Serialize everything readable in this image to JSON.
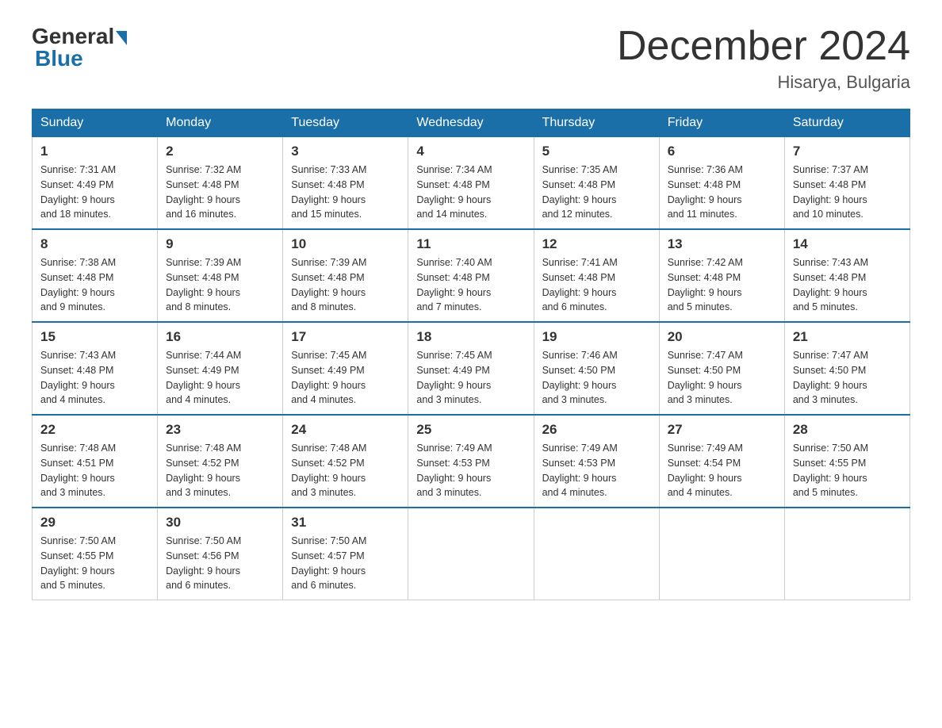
{
  "header": {
    "logo_general": "General",
    "logo_blue": "Blue",
    "month_title": "December 2024",
    "location": "Hisarya, Bulgaria"
  },
  "weekdays": [
    "Sunday",
    "Monday",
    "Tuesday",
    "Wednesday",
    "Thursday",
    "Friday",
    "Saturday"
  ],
  "weeks": [
    [
      {
        "day": "1",
        "sunrise": "7:31 AM",
        "sunset": "4:49 PM",
        "daylight": "9 hours and 18 minutes."
      },
      {
        "day": "2",
        "sunrise": "7:32 AM",
        "sunset": "4:48 PM",
        "daylight": "9 hours and 16 minutes."
      },
      {
        "day": "3",
        "sunrise": "7:33 AM",
        "sunset": "4:48 PM",
        "daylight": "9 hours and 15 minutes."
      },
      {
        "day": "4",
        "sunrise": "7:34 AM",
        "sunset": "4:48 PM",
        "daylight": "9 hours and 14 minutes."
      },
      {
        "day": "5",
        "sunrise": "7:35 AM",
        "sunset": "4:48 PM",
        "daylight": "9 hours and 12 minutes."
      },
      {
        "day": "6",
        "sunrise": "7:36 AM",
        "sunset": "4:48 PM",
        "daylight": "9 hours and 11 minutes."
      },
      {
        "day": "7",
        "sunrise": "7:37 AM",
        "sunset": "4:48 PM",
        "daylight": "9 hours and 10 minutes."
      }
    ],
    [
      {
        "day": "8",
        "sunrise": "7:38 AM",
        "sunset": "4:48 PM",
        "daylight": "9 hours and 9 minutes."
      },
      {
        "day": "9",
        "sunrise": "7:39 AM",
        "sunset": "4:48 PM",
        "daylight": "9 hours and 8 minutes."
      },
      {
        "day": "10",
        "sunrise": "7:39 AM",
        "sunset": "4:48 PM",
        "daylight": "9 hours and 8 minutes."
      },
      {
        "day": "11",
        "sunrise": "7:40 AM",
        "sunset": "4:48 PM",
        "daylight": "9 hours and 7 minutes."
      },
      {
        "day": "12",
        "sunrise": "7:41 AM",
        "sunset": "4:48 PM",
        "daylight": "9 hours and 6 minutes."
      },
      {
        "day": "13",
        "sunrise": "7:42 AM",
        "sunset": "4:48 PM",
        "daylight": "9 hours and 5 minutes."
      },
      {
        "day": "14",
        "sunrise": "7:43 AM",
        "sunset": "4:48 PM",
        "daylight": "9 hours and 5 minutes."
      }
    ],
    [
      {
        "day": "15",
        "sunrise": "7:43 AM",
        "sunset": "4:48 PM",
        "daylight": "9 hours and 4 minutes."
      },
      {
        "day": "16",
        "sunrise": "7:44 AM",
        "sunset": "4:49 PM",
        "daylight": "9 hours and 4 minutes."
      },
      {
        "day": "17",
        "sunrise": "7:45 AM",
        "sunset": "4:49 PM",
        "daylight": "9 hours and 4 minutes."
      },
      {
        "day": "18",
        "sunrise": "7:45 AM",
        "sunset": "4:49 PM",
        "daylight": "9 hours and 3 minutes."
      },
      {
        "day": "19",
        "sunrise": "7:46 AM",
        "sunset": "4:50 PM",
        "daylight": "9 hours and 3 minutes."
      },
      {
        "day": "20",
        "sunrise": "7:47 AM",
        "sunset": "4:50 PM",
        "daylight": "9 hours and 3 minutes."
      },
      {
        "day": "21",
        "sunrise": "7:47 AM",
        "sunset": "4:50 PM",
        "daylight": "9 hours and 3 minutes."
      }
    ],
    [
      {
        "day": "22",
        "sunrise": "7:48 AM",
        "sunset": "4:51 PM",
        "daylight": "9 hours and 3 minutes."
      },
      {
        "day": "23",
        "sunrise": "7:48 AM",
        "sunset": "4:52 PM",
        "daylight": "9 hours and 3 minutes."
      },
      {
        "day": "24",
        "sunrise": "7:48 AM",
        "sunset": "4:52 PM",
        "daylight": "9 hours and 3 minutes."
      },
      {
        "day": "25",
        "sunrise": "7:49 AM",
        "sunset": "4:53 PM",
        "daylight": "9 hours and 3 minutes."
      },
      {
        "day": "26",
        "sunrise": "7:49 AM",
        "sunset": "4:53 PM",
        "daylight": "9 hours and 4 minutes."
      },
      {
        "day": "27",
        "sunrise": "7:49 AM",
        "sunset": "4:54 PM",
        "daylight": "9 hours and 4 minutes."
      },
      {
        "day": "28",
        "sunrise": "7:50 AM",
        "sunset": "4:55 PM",
        "daylight": "9 hours and 5 minutes."
      }
    ],
    [
      {
        "day": "29",
        "sunrise": "7:50 AM",
        "sunset": "4:55 PM",
        "daylight": "9 hours and 5 minutes."
      },
      {
        "day": "30",
        "sunrise": "7:50 AM",
        "sunset": "4:56 PM",
        "daylight": "9 hours and 6 minutes."
      },
      {
        "day": "31",
        "sunrise": "7:50 AM",
        "sunset": "4:57 PM",
        "daylight": "9 hours and 6 minutes."
      },
      null,
      null,
      null,
      null
    ]
  ]
}
